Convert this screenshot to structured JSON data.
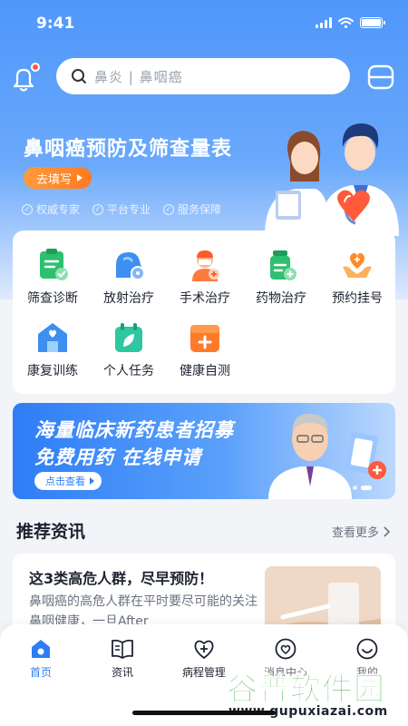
{
  "status": {
    "time": "9:41"
  },
  "header": {
    "search_placeholder": "鼻炎 | 鼻咽癌"
  },
  "banner": {
    "title": "鼻咽癌预防及筛查量表",
    "button": "去填写",
    "tags": [
      "权威专家",
      "平台专业",
      "服务保障"
    ]
  },
  "services": [
    {
      "label": "筛查诊断",
      "icon": "clipboard-check-icon"
    },
    {
      "label": "放射治疗",
      "icon": "radiation-head-icon"
    },
    {
      "label": "手术治疗",
      "icon": "surgeon-icon"
    },
    {
      "label": "药物治疗",
      "icon": "medicine-bottle-icon"
    },
    {
      "label": "预约挂号",
      "icon": "hand-heart-icon"
    },
    {
      "label": "康复训练",
      "icon": "rehab-house-icon"
    },
    {
      "label": "个人任务",
      "icon": "calendar-leaf-icon"
    },
    {
      "label": "健康自测",
      "icon": "medical-kit-icon"
    }
  ],
  "promo": {
    "line1": "海量临床新药患者招募",
    "line2": "免费用药 在线申请",
    "button": "点击查看"
  },
  "recommend": {
    "title": "推荐资讯",
    "more": "查看更多"
  },
  "news": {
    "title": "这3类高危人群，尽早预防！",
    "desc": "鼻咽癌的高危人群在平时要尽可能的关注鼻咽健康，一旦After"
  },
  "tabs": [
    {
      "label": "首页",
      "icon": "home-icon",
      "active": true
    },
    {
      "label": "资讯",
      "icon": "book-icon"
    },
    {
      "label": "病程管理",
      "icon": "heart-plus-icon"
    },
    {
      "label": "消息中心",
      "icon": "message-heart-icon"
    },
    {
      "label": "我的",
      "icon": "smile-icon"
    }
  ],
  "watermark": {
    "main": "谷普软件园",
    "url": "www.gupuxiazai.com"
  },
  "colors": {
    "primary": "#2e7df6",
    "accent": "#ff7a1f",
    "bell_dot": "#ff5a3c",
    "watermark_green": "#2fae3a"
  }
}
